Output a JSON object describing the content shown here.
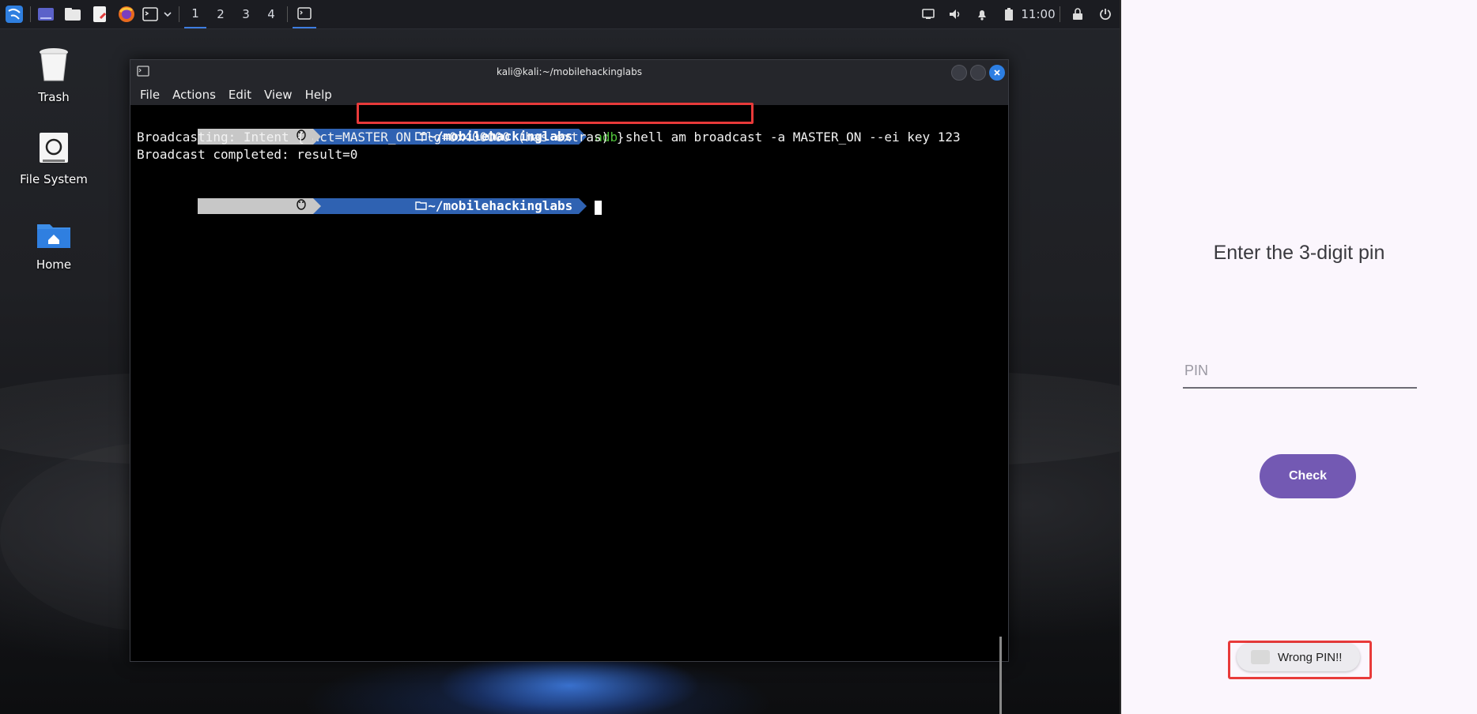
{
  "taskbar": {
    "workspaces": [
      "1",
      "2",
      "3",
      "4"
    ],
    "active_workspace": "1",
    "clock": "11:00",
    "icons": [
      "kali-menu-icon",
      "desktop-icon",
      "file-manager-icon",
      "text-editor-icon",
      "firefox-icon",
      "terminal-icon",
      "chevron-down-icon",
      "terminal-window-icon",
      "display-icon",
      "volume-icon",
      "bell-icon",
      "battery-icon",
      "lock-icon",
      "power-icon"
    ]
  },
  "desktop_icons": [
    {
      "label": "Trash",
      "icon": "trash-icon"
    },
    {
      "label": "File System",
      "icon": "drive-icon"
    },
    {
      "label": "Home",
      "icon": "home-folder-icon"
    }
  ],
  "terminal": {
    "title": "kali@kali:~/mobilehackinglabs",
    "menu": [
      "File",
      "Actions",
      "Edit",
      "View",
      "Help"
    ],
    "prompt_path": "~/mobilehackinglabs",
    "command_tool": "adb",
    "command_args": " shell am broadcast -a MASTER_ON --ei key 123",
    "output": [
      "Broadcasting: Intent { act=MASTER_ON flg=0x400000 (has extras) }",
      "Broadcast completed: result=0"
    ]
  },
  "android": {
    "title": "Enter the 3-digit pin",
    "pin_placeholder": "PIN",
    "check_label": "Check",
    "toast": "Wrong PIN!!"
  },
  "colors": {
    "accent_purple": "#7359b3",
    "highlight_red": "#e83a3a",
    "prompt_blue": "#2f62b2",
    "command_green": "#4fc23a"
  }
}
